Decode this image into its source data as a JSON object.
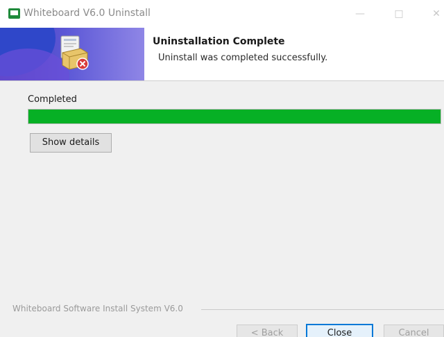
{
  "window": {
    "title": "Whiteboard V6.0 Uninstall",
    "controls": {
      "minimize": "—",
      "maximize": "□",
      "close": "✕"
    },
    "icon": "whiteboard-app-icon"
  },
  "header": {
    "title": "Uninstallation Complete",
    "subtitle": "Uninstall was completed successfully.",
    "icon": "uninstall-box-icon"
  },
  "body": {
    "status_label": "Completed",
    "progress_percent": 100,
    "progress_color": "#06b025",
    "show_details_label": "Show details"
  },
  "footer": {
    "branding": "Whiteboard Software Install System V6.0",
    "back_label": "< Back",
    "close_label": "Close",
    "cancel_label": "Cancel"
  },
  "colors": {
    "accent": "#0078d7",
    "banner": "#5b57d6",
    "progress": "#06b025"
  }
}
